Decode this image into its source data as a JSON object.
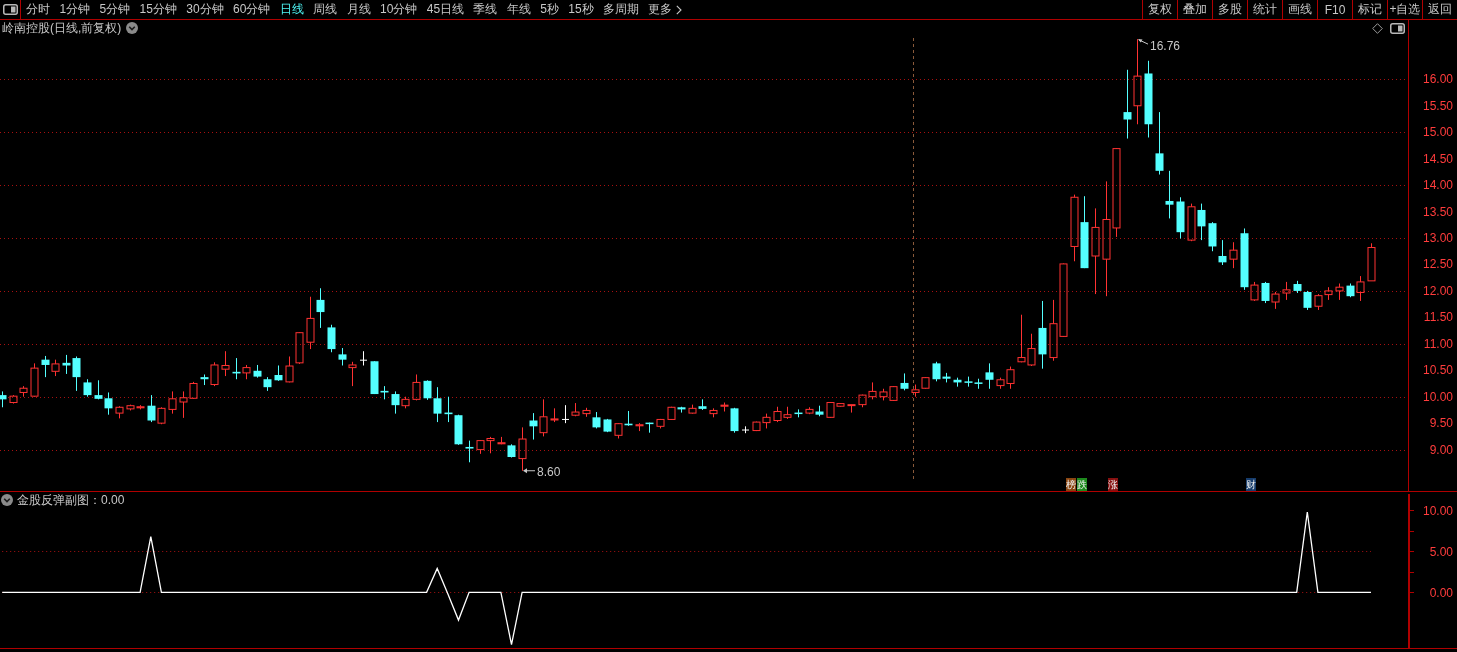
{
  "toolbar": {
    "periods": [
      {
        "label": "分时",
        "selected": false
      },
      {
        "label": "1分钟",
        "selected": false
      },
      {
        "label": "5分钟",
        "selected": false
      },
      {
        "label": "15分钟",
        "selected": false
      },
      {
        "label": "30分钟",
        "selected": false
      },
      {
        "label": "60分钟",
        "selected": false
      },
      {
        "label": "日线",
        "selected": true
      },
      {
        "label": "周线",
        "selected": false
      },
      {
        "label": "月线",
        "selected": false
      },
      {
        "label": "10分钟",
        "selected": false
      },
      {
        "label": "45日线",
        "selected": false
      },
      {
        "label": "季线",
        "selected": false
      },
      {
        "label": "年线",
        "selected": false
      },
      {
        "label": "5秒",
        "selected": false
      },
      {
        "label": "15秒",
        "selected": false
      },
      {
        "label": "多周期",
        "selected": false
      }
    ],
    "more": "更多",
    "actions": [
      "复权",
      "叠加",
      "多股",
      "统计",
      "画线",
      "F10",
      "标记",
      "+自选",
      "返回"
    ]
  },
  "price_chart": {
    "title": "岭南控股(日线,前复权)",
    "yticks": [
      "16.00",
      "15.50",
      "15.00",
      "14.50",
      "14.00",
      "13.50",
      "13.00",
      "12.50",
      "12.00",
      "11.50",
      "11.00",
      "10.50",
      "10.00",
      "9.50",
      "9.00"
    ],
    "annotations": [
      {
        "kind": "high",
        "text": "16.76"
      },
      {
        "kind": "low",
        "text": "8.60"
      }
    ],
    "markers": [
      {
        "label": "榜",
        "color": "#8a4510"
      },
      {
        "label": "跌",
        "color": "#1e8a1e"
      },
      {
        "label": "涨",
        "color": "#861010"
      },
      {
        "label": "财",
        "color": "#163c6c"
      }
    ]
  },
  "indicator": {
    "title": "金股反弹副图：0.00",
    "chart_data": {
      "type": "line",
      "ylim": [
        -6.8,
        12.0
      ],
      "yticks": [
        {
          "value": 10,
          "label": "10.00"
        },
        {
          "value": 5,
          "label": "5.00"
        },
        {
          "value": 0,
          "label": "0.00"
        }
      ],
      "series": [
        {
          "color": "#ffffff",
          "values": [
            0,
            0,
            0,
            0,
            0,
            0,
            0,
            0,
            0,
            0,
            0,
            0,
            0,
            0,
            6.8,
            0,
            0,
            0,
            0,
            0,
            0,
            0,
            0,
            0,
            0,
            0,
            0,
            0,
            0,
            0,
            0,
            0,
            0,
            0,
            0,
            0,
            0,
            0,
            0,
            0,
            0,
            2.9,
            -0.2,
            -3.4,
            0,
            0,
            0,
            0,
            -6.4,
            0,
            0,
            0,
            0,
            0,
            0,
            0,
            0,
            0,
            0,
            0,
            0,
            0,
            0,
            0,
            0,
            0,
            0,
            0,
            0,
            0,
            0,
            0,
            0,
            0,
            0,
            0,
            0,
            0,
            0,
            0,
            0,
            0,
            0,
            0,
            0,
            0,
            0,
            0,
            0,
            0,
            0,
            0,
            0,
            0,
            0,
            0,
            0,
            0,
            0,
            0,
            0,
            0,
            0,
            0,
            0,
            0,
            0,
            0,
            0,
            0,
            0,
            0,
            0,
            0,
            0,
            0,
            0,
            0,
            0,
            0,
            0,
            0,
            0,
            9.8,
            0,
            0,
            0,
            0,
            0,
            0
          ]
        }
      ]
    }
  }
}
